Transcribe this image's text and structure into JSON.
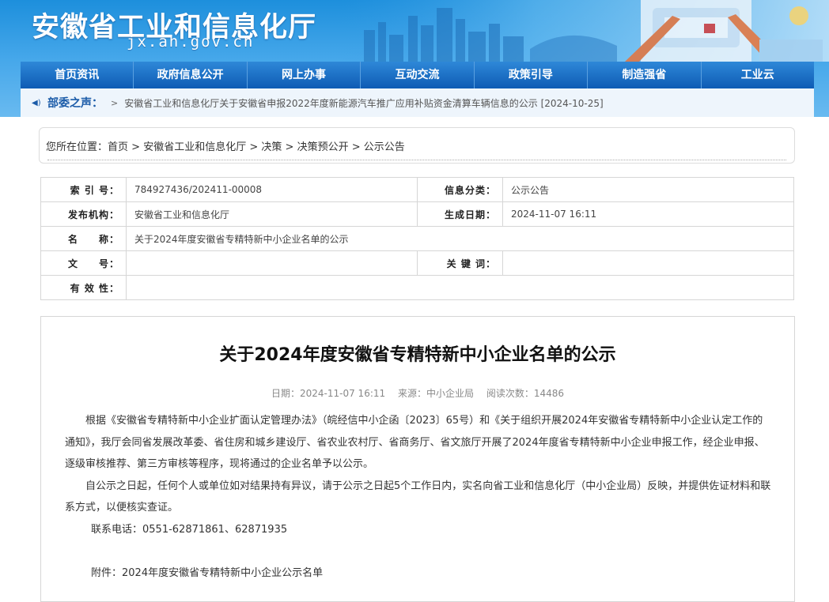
{
  "header": {
    "site_title": "安徽省工业和信息化厅",
    "site_url": "jx.ah.gov.cn",
    "brand_color": "#1d8fdc"
  },
  "nav": {
    "items": [
      "首页资讯",
      "政府信息公开",
      "网上办事",
      "互动交流",
      "政策引导",
      "制造强省",
      "工业云"
    ]
  },
  "notice": {
    "label": "部委之声：",
    "text": "安徽省工业和信息化厅关于安徽省申报2022年度新能源汽车推广应用补贴资金清算车辆信息的公示 [2024-10-25]"
  },
  "breadcrumb": {
    "prefix": "您所在位置：",
    "items": [
      "首页",
      "安徽省工业和信息化厅",
      "决策",
      "决策预公开",
      "公示公告"
    ],
    "sep": " > "
  },
  "info": {
    "index_label": "索 引 号：",
    "index_value": "784927436/202411-00008",
    "category_label": "信息分类：",
    "category_value": "公示公告",
    "publisher_label": "发布机构：",
    "publisher_value": "安徽省工业和信息化厅",
    "date_label": "生成日期：",
    "date_value": "2024-11-07 16:11",
    "name_label": "名　　称：",
    "name_value": "关于2024年度安徽省专精特新中小企业名单的公示",
    "docno_label": "文　　号：",
    "docno_value": "",
    "keyword_label": "关 键 词：",
    "keyword_value": "",
    "validity_label": "有 效 性：",
    "validity_value": ""
  },
  "article": {
    "title": "关于2024年度安徽省专精特新中小企业名单的公示",
    "meta_date": "日期：2024-11-07 16:11",
    "meta_source": "来源：中小企业局",
    "meta_views": "阅读次数：14486",
    "para1": "根据《安徽省专精特新中小企业扩面认定管理办法》（皖经信中小企函〔2023〕65号）和《关于组织开展2024年安徽省专精特新中小企业认定工作的通知》，我厅会同省发展改革委、省住房和城乡建设厅、省农业农村厅、省商务厅、省文旅厅开展了2024年度省专精特新中小企业申报工作，经企业申报、逐级审核推荐、第三方审核等程序，现将通过的企业名单予以公示。",
    "para2": "自公示之日起，任何个人或单位如对结果持有异议，请于公示之日起5个工作日内，实名向省工业和信息化厅（中小企业局）反映，并提供佐证材料和联系方式，以便核实查证。",
    "tel": "联系电话：0551-62871861、62871935",
    "attachment": "附件：2024年度安徽省专精特新中小企业公示名单"
  }
}
